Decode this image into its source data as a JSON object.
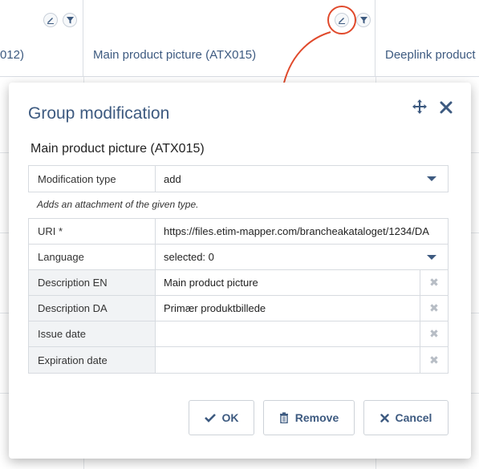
{
  "background": {
    "columns": [
      {
        "title": "012)"
      },
      {
        "title": "Main product picture (ATX015)"
      },
      {
        "title": "Deeplink product"
      }
    ],
    "icons": [
      "edit-icon",
      "filter-icon"
    ],
    "accent": "#e0492b"
  },
  "modal": {
    "title": "Group modification",
    "section_title": "Main product picture (ATX015)",
    "modification_type": {
      "label": "Modification type",
      "value": "add"
    },
    "hint": "Adds an attachment of the given type.",
    "fields": [
      {
        "label": "URI *",
        "value": "https://files.etim-mapper.com/brancheakataloget/1234/DA",
        "clearable": false
      },
      {
        "label": "Language",
        "value": "selected: 0",
        "dropdown": true
      },
      {
        "label": "Description EN",
        "value": "Main product picture",
        "clearable": true
      },
      {
        "label": "Description DA",
        "value": "Primær produktbillede",
        "clearable": true
      },
      {
        "label": "Issue date",
        "value": "",
        "clearable": true
      },
      {
        "label": "Expiration date",
        "value": "",
        "clearable": true
      }
    ],
    "buttons": {
      "ok": "OK",
      "remove": "Remove",
      "cancel": "Cancel"
    },
    "colors": {
      "primary": "#3d5a80",
      "border": "#d7dbe0"
    }
  }
}
